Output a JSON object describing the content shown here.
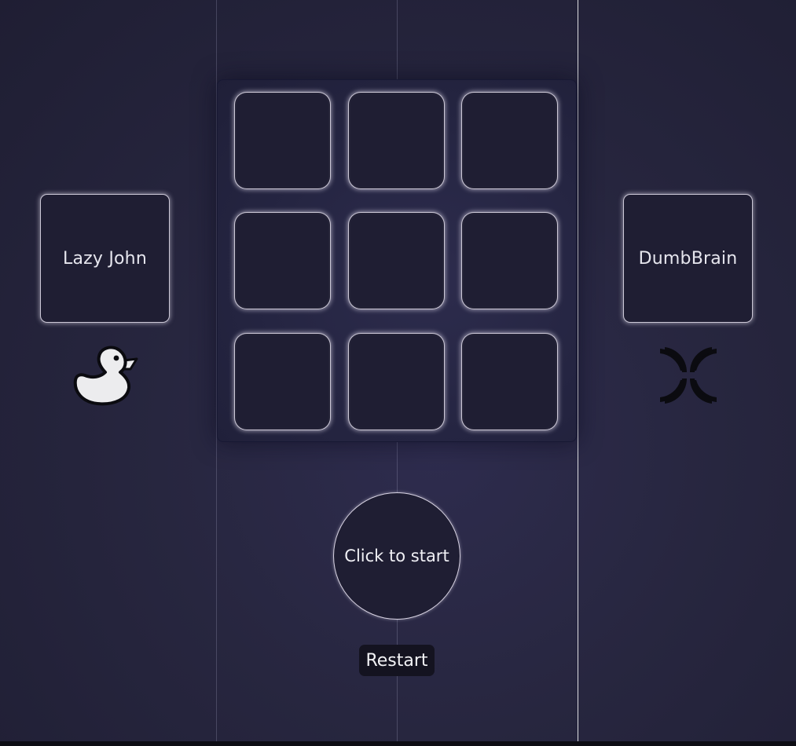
{
  "board": {
    "cells": [
      "",
      "",
      "",
      "",
      "",
      "",
      "",
      "",
      ""
    ]
  },
  "players": {
    "left": {
      "name": "Lazy John",
      "icon": "duck-icon"
    },
    "right": {
      "name": "DumbBrain",
      "icon": "four-arcs-icon"
    }
  },
  "controls": {
    "start_label": "Click to start",
    "restart_label": "Restart"
  },
  "colors": {
    "background": "#27263f",
    "cell_fill": "#1f1e33",
    "cell_glow": "#ebe6f5",
    "restart_bg": "#141320"
  }
}
